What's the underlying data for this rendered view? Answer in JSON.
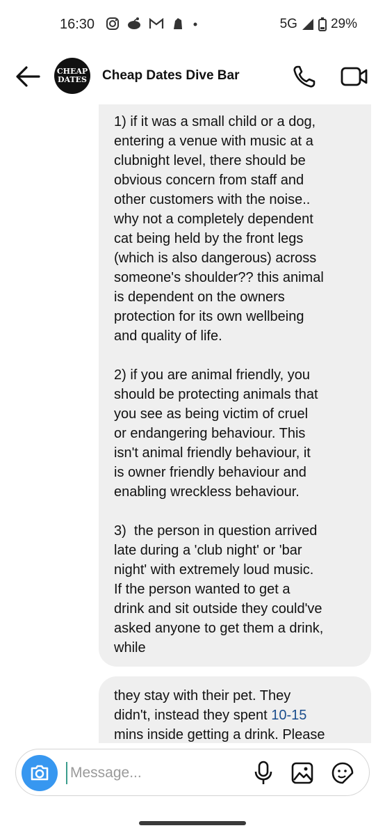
{
  "status_bar": {
    "time": "16:30",
    "network": "5G",
    "battery": "29%",
    "notification_icons": [
      "instagram-icon",
      "reddit-icon",
      "gmail-icon",
      "premier-league-icon",
      "dot-icon"
    ]
  },
  "header": {
    "title": "Cheap Dates Dive Bar",
    "avatar_text_line1": "CHEAP",
    "avatar_text_line2": "DATES"
  },
  "messages": [
    {
      "text": "1) if it was a small child or a dog,\nentering a venue with music at a\nclubnight level, there should be\nobvious concern from staff and\nother customers with the noise..\nwhy not a completely dependent\ncat being held by the front legs\n(which is also dangerous) across\nsomeone's shoulder?? this animal\nis dependent on the owners\nprotection for its own wellbeing\nand quality of life.\n\n2) if you are animal friendly, you\nshould be protecting animals that\nyou see as being victim of cruel\nor endangering behaviour. This\nisn't animal friendly behaviour, it\nis owner friendly behaviour and\nenabling wreckless behaviour.\n\n3)  the person in question arrived\nlate during a 'club night' or 'bar\nnight' with extremely loud music.\nIf the person wanted to get a\ndrink and sit outside they could've\nasked anyone to get them a drink,\nwhile"
    },
    {
      "text_before": "they stay with their pet. They\ndidn't, instead they spent ",
      "link": "10-15",
      "text_after": "\nmins inside getting a drink. Please"
    }
  ],
  "composer": {
    "placeholder": "Message..."
  },
  "colors": {
    "bubble": "#efefef",
    "accent": "#3797f0",
    "link": "#1a4d8c"
  }
}
